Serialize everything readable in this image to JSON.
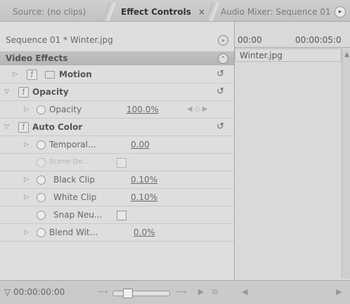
{
  "tabs": [
    {
      "label": "Source: (no clips)",
      "active": false
    },
    {
      "label": "Effect Controls",
      "active": true,
      "close": "×"
    },
    {
      "label": "Audio Mixer: Sequence 01",
      "active": false
    }
  ],
  "panel": {
    "sequence_label": "Sequence 01 * Winter.jpg",
    "video_effects_label": "Video Effects"
  },
  "effects": {
    "motion": {
      "label": "Motion"
    },
    "opacity": {
      "label": "Opacity",
      "param_label": "Opacity",
      "param_value": "100.0%"
    },
    "auto_color": {
      "label": "Auto Color",
      "params": {
        "temporal": {
          "label": "Temporal...",
          "value": "0.00"
        },
        "scene_detect": {
          "label": "Scene De..."
        },
        "black_clip": {
          "label": "Black Clip",
          "value": "0.10%"
        },
        "white_clip": {
          "label": "White Clip",
          "value": "0.10%"
        },
        "snap_neutral": {
          "label": "Snap Neu..."
        },
        "blend_with": {
          "label": "Blend Wit...",
          "value": "0.0%"
        }
      }
    }
  },
  "timeline": {
    "start_tc": "00:00",
    "end_tc": "00:00:05:0",
    "clip_name": "Winter.jpg"
  },
  "footer": {
    "timecode": "00:00:00:00"
  },
  "icons": {
    "stopwatch": "stopwatch-icon",
    "fx": "fx-toggle-icon",
    "reset": "reset-icon",
    "expand": "triangle-icon"
  }
}
